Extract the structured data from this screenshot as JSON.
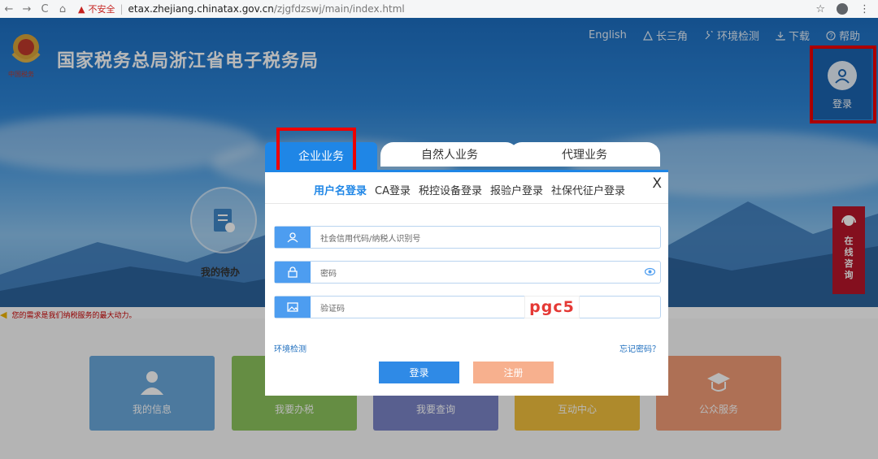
{
  "browser": {
    "back": "←",
    "forward": "→",
    "reload": "C",
    "home": "⌂",
    "warn_glyph": "▲",
    "security_label": "不安全",
    "divider": "|",
    "url_host": "etax.zhejiang.chinatax.gov.cn",
    "url_path": "/zjgfdzswj/main/index.html",
    "star": "☆",
    "menu": "⋮"
  },
  "header": {
    "site_title": "国家税务总局浙江省电子税务局",
    "links": [
      {
        "label": "English",
        "icon": ""
      },
      {
        "label": "长三角",
        "icon": "triangle-icon"
      },
      {
        "label": "环境检测",
        "icon": "wrench-icon"
      },
      {
        "label": "下载",
        "icon": "download-icon"
      },
      {
        "label": "帮助",
        "icon": "help-icon"
      }
    ],
    "login_label": "登录"
  },
  "background": {
    "todo_label": "我的待办",
    "consult_label": "在线咨询",
    "notice": "您的需求是我们纳税服务的最大动力。",
    "tiles": [
      {
        "label": "我的信息",
        "color": "#6aa8dc"
      },
      {
        "label": "我要办税",
        "color": "#8dc45d"
      },
      {
        "label": "我要查询",
        "color": "#7a84c7"
      },
      {
        "label": "互动中心",
        "color": "#f1c03d"
      },
      {
        "label": "公众服务",
        "color": "#f19c76"
      }
    ]
  },
  "modal": {
    "tabs": [
      "企业业务",
      "自然人业务",
      "代理业务"
    ],
    "close": "X",
    "subtabs": [
      "用户名登录",
      "CA登录",
      "税控设备登录",
      "报验户登录",
      "社保代征户登录"
    ],
    "fields": {
      "username_placeholder": "社会信用代码/纳税人识别号",
      "password_placeholder": "密码",
      "captcha_placeholder": "验证码",
      "captcha_code": "pgc5"
    },
    "env_link": "环境检测",
    "forgot_link": "忘记密码？",
    "login_button": "登录",
    "register_button": "注册"
  },
  "colors": {
    "accent": "#1f86e6",
    "highlight": "#ee0000",
    "register": "#f7b08e"
  }
}
